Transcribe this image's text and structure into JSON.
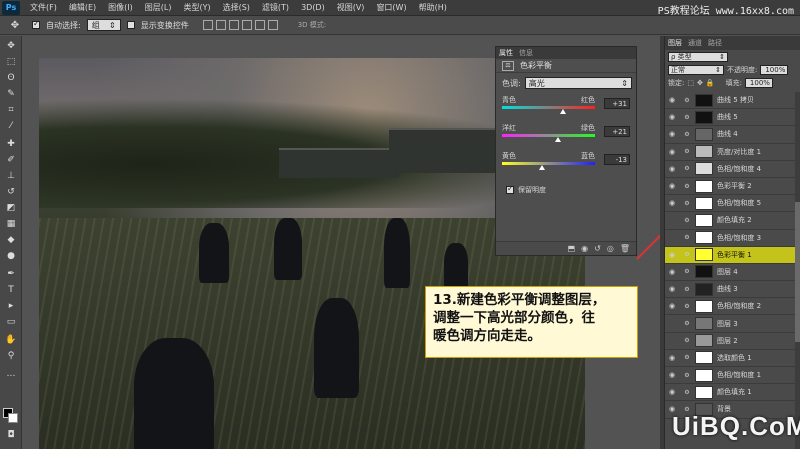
{
  "menubar": {
    "logo": "Ps",
    "items": [
      "文件(F)",
      "编辑(E)",
      "图像(I)",
      "图层(L)",
      "类型(Y)",
      "选择(S)",
      "滤镜(T)",
      "3D(D)",
      "视图(V)",
      "窗口(W)",
      "帮助(H)"
    ],
    "watermark": "PS教程论坛 www.16xx8.com"
  },
  "options": {
    "auto_select_label": "自动选择:",
    "auto_select_value": "组",
    "show_transform_label": "显示变换控件",
    "mode_3d_label": "3D 模式:"
  },
  "properties": {
    "tabs": [
      "属性",
      "信息"
    ],
    "title": "色彩平衡",
    "tone_label": "色调:",
    "tone_value": "高光",
    "sliders": [
      {
        "left": "青色",
        "right": "红色",
        "value": "+31",
        "level": 31
      },
      {
        "left": "洋红",
        "right": "绿色",
        "value": "+21",
        "level": 21
      },
      {
        "left": "黄色",
        "right": "蓝色",
        "value": "-13",
        "level": -13
      }
    ],
    "preserve_label": "保留明度"
  },
  "layers": {
    "tabs": [
      "图层",
      "通道",
      "路径"
    ],
    "kind_label": "ρ 类型",
    "blend_mode": "正常",
    "opacity_label": "不透明度:",
    "opacity_value": "100%",
    "lock_label": "锁定:",
    "fill_label": "填充:",
    "fill_value": "100%",
    "items": [
      {
        "name": "曲线 5 拷贝",
        "visible": true,
        "mask": "#111111",
        "selected": false
      },
      {
        "name": "曲线 5",
        "visible": true,
        "mask": "#111111",
        "selected": false
      },
      {
        "name": "曲线 4",
        "visible": true,
        "mask": "#666666",
        "selected": false
      },
      {
        "name": "亮度/对比度 1",
        "visible": true,
        "mask": "#bbbbbb",
        "selected": false
      },
      {
        "name": "色相/饱和度 4",
        "visible": true,
        "mask": "#dddddd",
        "selected": false
      },
      {
        "name": "色彩平衡 2",
        "visible": true,
        "mask": "#ffffff",
        "selected": false
      },
      {
        "name": "色相/饱和度 5",
        "visible": true,
        "mask": "#ffffff",
        "selected": false
      },
      {
        "name": "颜色填充 2",
        "visible": false,
        "mask": "#ffffff",
        "selected": false
      },
      {
        "name": "色相/饱和度 3",
        "visible": false,
        "mask": "#ffffff",
        "selected": false
      },
      {
        "name": "色彩平衡 1",
        "visible": true,
        "mask": "#ffff33",
        "selected": true
      },
      {
        "name": "图层 4",
        "visible": true,
        "mask": "#111111",
        "selected": false
      },
      {
        "name": "曲线 3",
        "visible": true,
        "mask": "#222222",
        "selected": false
      },
      {
        "name": "色相/饱和度 2",
        "visible": true,
        "mask": "#ffffff",
        "selected": false
      },
      {
        "name": "图层 3",
        "visible": false,
        "mask": "#777777",
        "selected": false
      },
      {
        "name": "图层 2",
        "visible": false,
        "mask": "#999999",
        "selected": false
      },
      {
        "name": "选取颜色 1",
        "visible": true,
        "mask": "#ffffff",
        "selected": false
      },
      {
        "name": "色相/饱和度 1",
        "visible": true,
        "mask": "#ffffff",
        "selected": false
      },
      {
        "name": "颜色填充 1",
        "visible": true,
        "mask": "#ffffff",
        "selected": false
      },
      {
        "name": "背景",
        "visible": true,
        "mask": "#555555",
        "selected": false
      }
    ]
  },
  "callout": {
    "lines": [
      "13.新建色彩平衡调整图层，",
      "调整一下高光部分颜色，往",
      "暖色调方向走走。"
    ]
  },
  "watermark_bottom": "UiBQ.CoM"
}
